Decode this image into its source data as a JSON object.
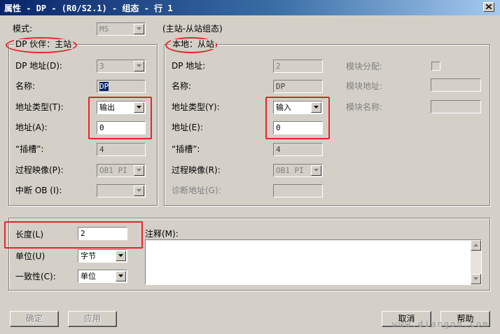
{
  "window": {
    "title": "属性 - DP - (R0/S2.1) - 组态 - 行 1"
  },
  "mode": {
    "label": "模式:",
    "value": "MS",
    "description": "(主站-从站组态)"
  },
  "partner": {
    "legend": "DP 伙伴：主站",
    "dp_address": {
      "label": "DP 地址(D):",
      "value": "3"
    },
    "name": {
      "label": "名称:",
      "value": "DP"
    },
    "address_type": {
      "label": "地址类型(T):",
      "value": "输出"
    },
    "address": {
      "label": "地址(A):",
      "value": "0"
    },
    "slot": {
      "label": "“插槽”:",
      "value": "4"
    },
    "process_image": {
      "label": "过程映像(P):",
      "value": "OB1 PI"
    },
    "interrupt_ob": {
      "label": "中断 OB (I):",
      "value": ""
    }
  },
  "local": {
    "legend": "本地：从站",
    "dp_address": {
      "label": "DP 地址:",
      "value": "2"
    },
    "name": {
      "label": "名称:",
      "value": "DP"
    },
    "address_type": {
      "label": "地址类型(Y):",
      "value": "输入"
    },
    "address": {
      "label": "地址(E):",
      "value": "0"
    },
    "slot": {
      "label": "“插槽”:",
      "value": "4"
    },
    "process_image": {
      "label": "过程映像(R):",
      "value": "OB1 PI"
    },
    "diag_address": {
      "label": "诊断地址(G):",
      "value": ""
    },
    "module_assign": {
      "label": "模块分配:",
      "checked": false
    },
    "module_address": {
      "label": "模块地址:",
      "value": ""
    },
    "module_name": {
      "label": "模块名称:",
      "value": ""
    }
  },
  "bottom": {
    "length": {
      "label": "长度(L)",
      "value": "2"
    },
    "unit": {
      "label": "单位(U)",
      "value": "字节"
    },
    "consistency": {
      "label": "一致性(C):",
      "value": "单位"
    },
    "comment": {
      "label": "注释(M):",
      "value": ""
    }
  },
  "buttons": {
    "ok": "确定",
    "apply": "应用",
    "cancel": "取消",
    "help": "帮助"
  },
  "watermark": "www.diangon.com"
}
